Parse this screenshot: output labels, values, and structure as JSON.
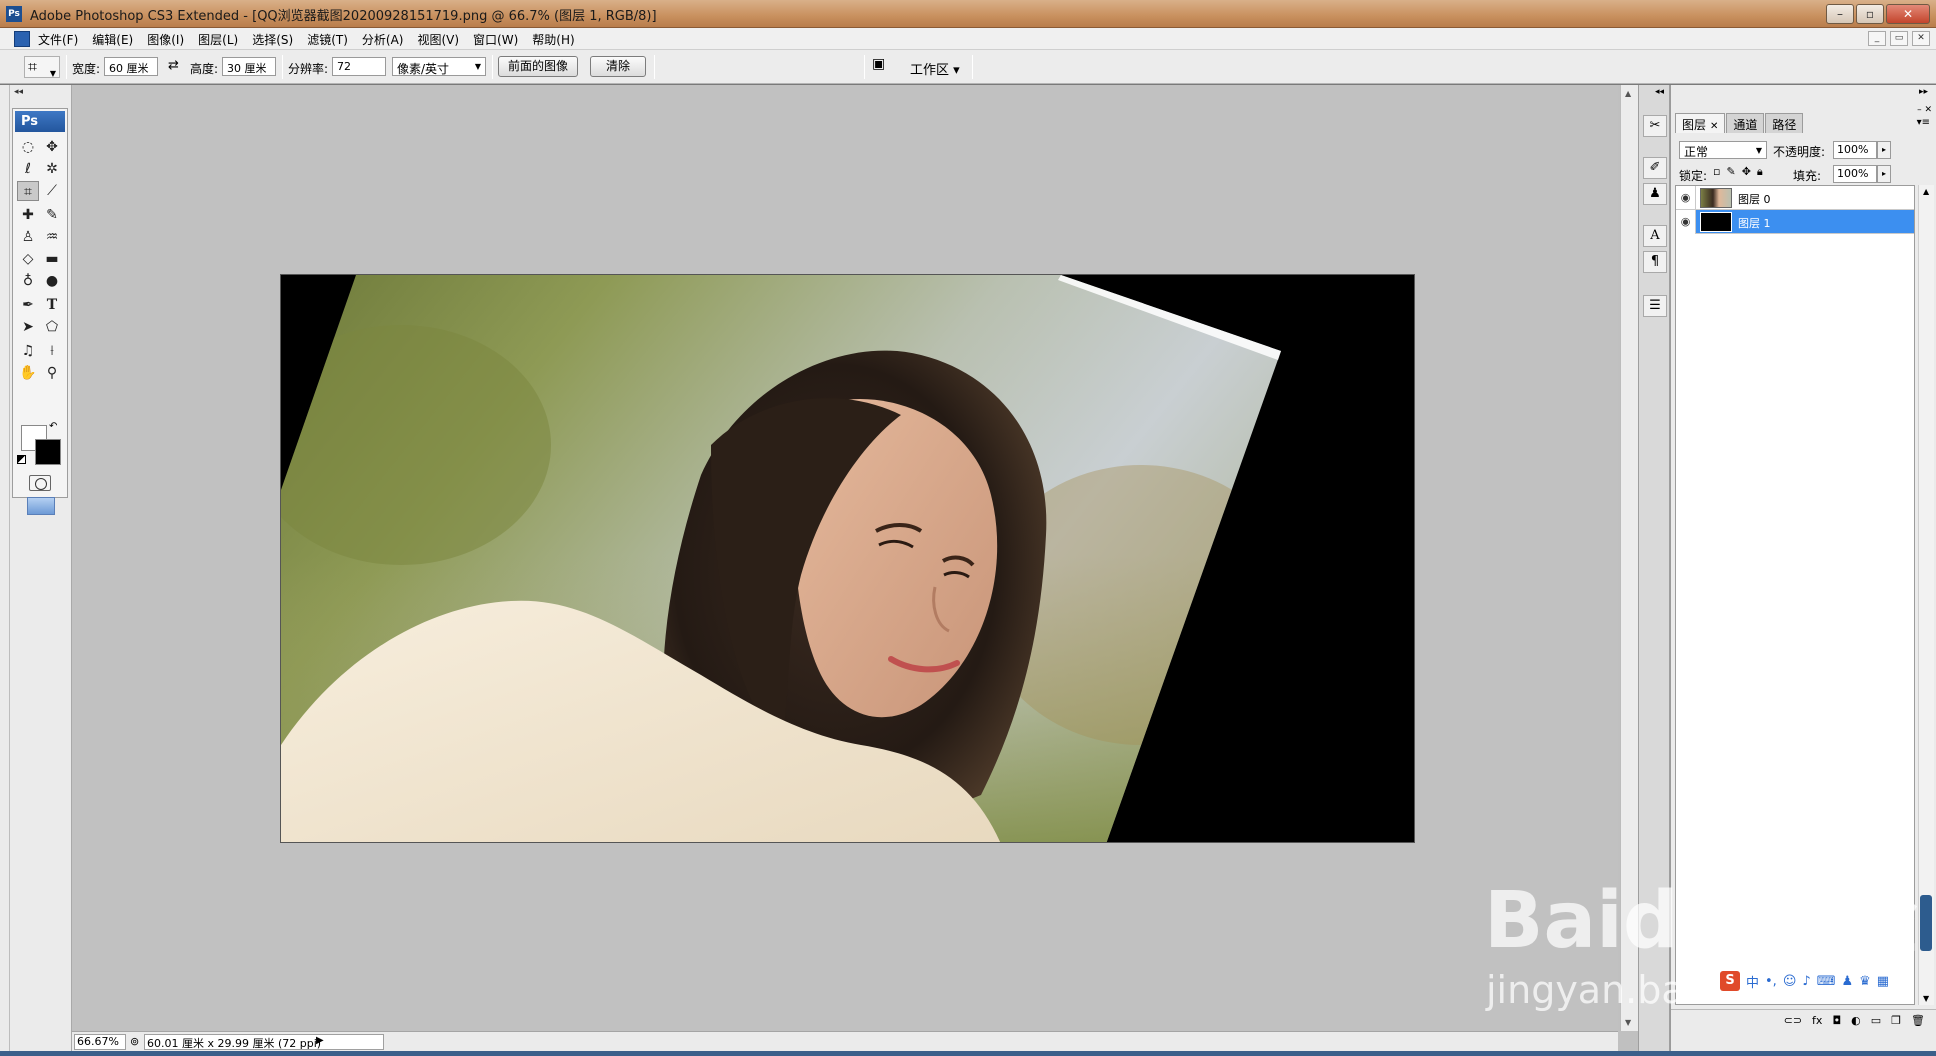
{
  "window": {
    "title": "Adobe Photoshop CS3 Extended - [QQ浏览器截图20200928151719.png @ 66.7% (图层 1, RGB/8)]",
    "app_badge": "Ps"
  },
  "menu": [
    "文件(F)",
    "编辑(E)",
    "图像(I)",
    "图层(L)",
    "选择(S)",
    "滤镜(T)",
    "分析(A)",
    "视图(V)",
    "窗口(W)",
    "帮助(H)"
  ],
  "options": {
    "width_label": "宽度:",
    "width_value": "60 厘米",
    "height_label": "高度:",
    "height_value": "30 厘米",
    "resolution_label": "分辨率:",
    "resolution_value": "72",
    "unit": "像素/英寸",
    "front_image_button": "前面的图像",
    "clear_button": "清除",
    "workspace_label": "工作区"
  },
  "status": {
    "zoom": "66.67%",
    "doc_size": "60.01 厘米 x 29.99 厘米 (72 ppi)"
  },
  "layers_panel": {
    "tabs": [
      "图层",
      "通道",
      "路径"
    ],
    "blend_mode": "正常",
    "opacity_label": "不透明度:",
    "opacity_value": "100%",
    "lock_label": "锁定:",
    "fill_label": "填充:",
    "fill_value": "100%",
    "layers": [
      {
        "name": "图层 0",
        "visible": true,
        "selected": false
      },
      {
        "name": "图层 1",
        "visible": true,
        "selected": true
      }
    ]
  },
  "colors": {
    "foreground": "#ffffff",
    "background": "#000000",
    "selection": "#3c8ff0"
  },
  "watermark": {
    "brand": "Baidu 经验",
    "url": "jingyan.baidu.com"
  },
  "ime": {
    "label": "中"
  }
}
